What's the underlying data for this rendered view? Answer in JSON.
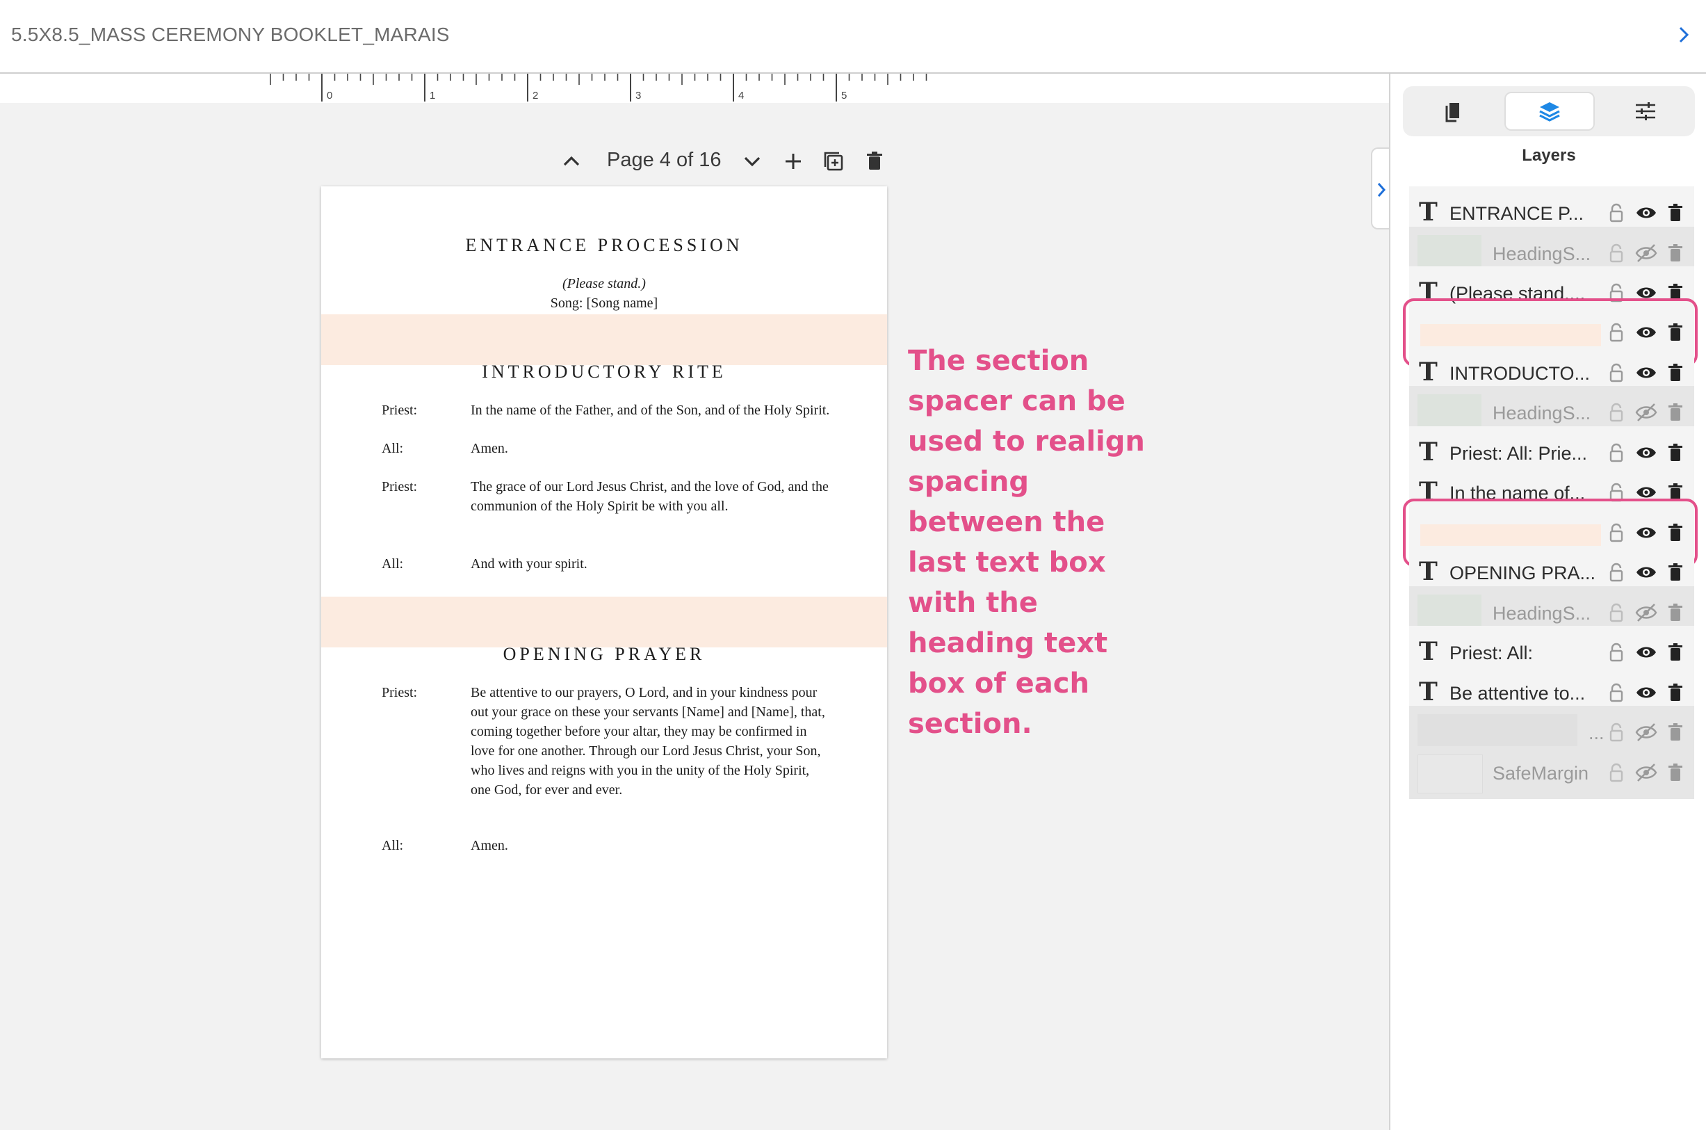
{
  "app": {
    "document_title": "5.5X8.5_MASS CEREMONY BOOKLET_MARAIS",
    "colors": {
      "accent": "#1e88e5",
      "annotation": "#e3508a",
      "spacer": "#fcebe0"
    }
  },
  "ruler": {
    "labels": [
      "0",
      "1",
      "2",
      "3",
      "4",
      "5"
    ]
  },
  "pagenav": {
    "label": "Page 4 of 16"
  },
  "page": {
    "heading1": "ENTRANCE PROCESSION",
    "please_stand": "(Please stand.)",
    "song": "Song: [Song name]",
    "heading2": "INTRODUCTORY RITE",
    "rite_rows": [
      {
        "speaker": "Priest:",
        "text": "In the name of the Father, and of the Son, and of the Holy Spirit."
      },
      {
        "speaker": "All:",
        "text": "Amen."
      },
      {
        "speaker": "Priest:",
        "text": "The grace of our Lord Jesus Christ, and the love of God, and the communion of the Holy Spirit be with you all."
      },
      {
        "speaker": "All:",
        "text": "And with your spirit."
      }
    ],
    "heading3": "OPENING PRAYER",
    "prayer_rows": [
      {
        "speaker": "Priest:",
        "text": "Be attentive to our prayers, O Lord, and in your kindness pour out your grace on these your servants [Name] and [Name], that, coming together before your altar, they may be confirmed in love for one another. Through our Lord Jesus Christ, your Son, who lives and reigns with you in the unity of the Holy Spirit, one God, for ever and ever."
      },
      {
        "speaker": "All:",
        "text": "Amen."
      }
    ]
  },
  "annotation": {
    "text": "The section spacer can be used to realign spacing between the last text box with the heading text box of each section."
  },
  "panel": {
    "title": "Layers",
    "tabs": [
      "pages-icon",
      "layers-icon",
      "settings-sliders-icon"
    ],
    "layers": [
      {
        "kind": "text",
        "name": "ENTRANCE P...",
        "visible": true
      },
      {
        "kind": "image",
        "name": "HeadingS...",
        "visible": false
      },
      {
        "kind": "text",
        "name": "(Please stand....",
        "visible": true
      },
      {
        "kind": "spacer",
        "name": "",
        "visible": true,
        "highlighted": true
      },
      {
        "kind": "text",
        "name": "INTRODUCTO...",
        "visible": true
      },
      {
        "kind": "image",
        "name": "HeadingS...",
        "visible": false
      },
      {
        "kind": "text",
        "name": "Priest: All: Prie...",
        "visible": true
      },
      {
        "kind": "text",
        "name": "In the name of...",
        "visible": true
      },
      {
        "kind": "spacer",
        "name": "",
        "visible": true,
        "highlighted": true
      },
      {
        "kind": "text",
        "name": "OPENING PRA...",
        "visible": true
      },
      {
        "kind": "image",
        "name": "HeadingS...",
        "visible": false
      },
      {
        "kind": "text",
        "name": "Priest: All:",
        "visible": true
      },
      {
        "kind": "text",
        "name": "Be attentive to...",
        "visible": true
      },
      {
        "kind": "image-wide",
        "name": "...",
        "visible": false
      },
      {
        "kind": "image-margin",
        "name": "SafeMargin",
        "visible": false
      }
    ]
  }
}
